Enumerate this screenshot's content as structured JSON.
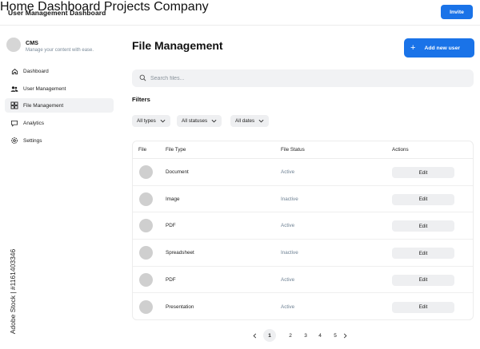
{
  "app": {
    "title": "User Management Dashboard"
  },
  "topnav": {
    "items": [
      "Home",
      "Dashboard",
      "Projects",
      "Company"
    ],
    "invite_label": "Invite"
  },
  "profile": {
    "name": "CMS",
    "subtitle": "Manage your content with ease."
  },
  "sidebar": {
    "items": [
      {
        "label": "Dashboard",
        "icon": "home-icon",
        "active": false
      },
      {
        "label": "User Management",
        "icon": "users-icon",
        "active": false
      },
      {
        "label": "File Management",
        "icon": "file-grid-icon",
        "active": true
      },
      {
        "label": "Analytics",
        "icon": "chat-icon",
        "active": false
      },
      {
        "label": "Settings",
        "icon": "gear-icon",
        "active": false
      }
    ]
  },
  "main": {
    "title": "File Management",
    "add_button_label": "Add new user",
    "search_placeholder": "Search files...",
    "filters_title": "Filters",
    "filters": [
      "All types",
      "All statuses",
      "All dates"
    ]
  },
  "table": {
    "columns": [
      "File",
      "File Type",
      "File Status",
      "Actions"
    ],
    "rows": [
      {
        "type": "Document",
        "status": "Active",
        "action": "Edit"
      },
      {
        "type": "Image",
        "status": "Inactive",
        "action": "Edit"
      },
      {
        "type": "PDF",
        "status": "Active",
        "action": "Edit"
      },
      {
        "type": "Spreadsheet",
        "status": "Inactive",
        "action": "Edit"
      },
      {
        "type": "PDF",
        "status": "Active",
        "action": "Edit"
      },
      {
        "type": "Presentation",
        "status": "Active",
        "action": "Edit"
      }
    ]
  },
  "pagination": {
    "pages": [
      "1",
      "2",
      "3",
      "4",
      "5"
    ],
    "current": "1"
  },
  "watermark": "Adobe Stock | #1161403346",
  "colors": {
    "accent": "#1a73e8",
    "status_text": "#6f8294",
    "chip_bg": "#eeeff1"
  }
}
